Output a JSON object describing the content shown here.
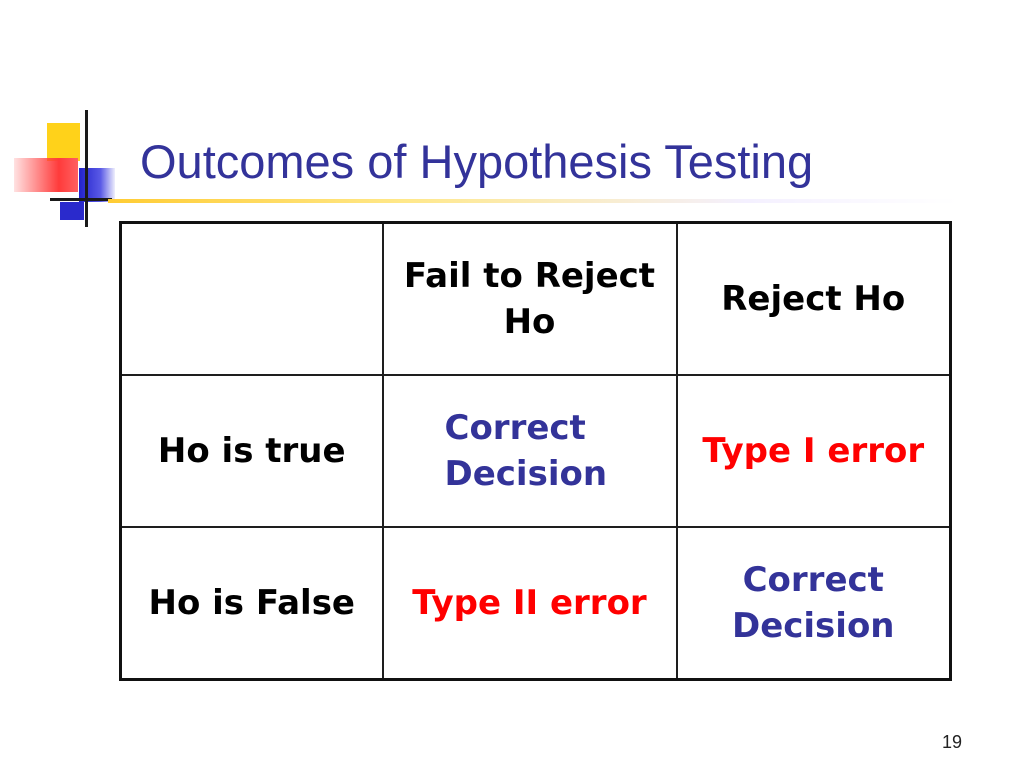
{
  "slide": {
    "title": "Outcomes of Hypothesis Testing",
    "page_number": "19"
  },
  "colors": {
    "title": "#33339a",
    "correct": "#333399",
    "error": "#ff0000",
    "label": "#000000"
  },
  "table": {
    "columns": [
      "",
      "Fail to Reject Ho",
      "Reject Ho"
    ],
    "rows": [
      {
        "label": "Ho is true",
        "cells": [
          "Correct Decision",
          "Type I error"
        ]
      },
      {
        "label": "Ho is False",
        "cells": [
          "Type II error",
          "Correct Decision"
        ]
      }
    ]
  }
}
